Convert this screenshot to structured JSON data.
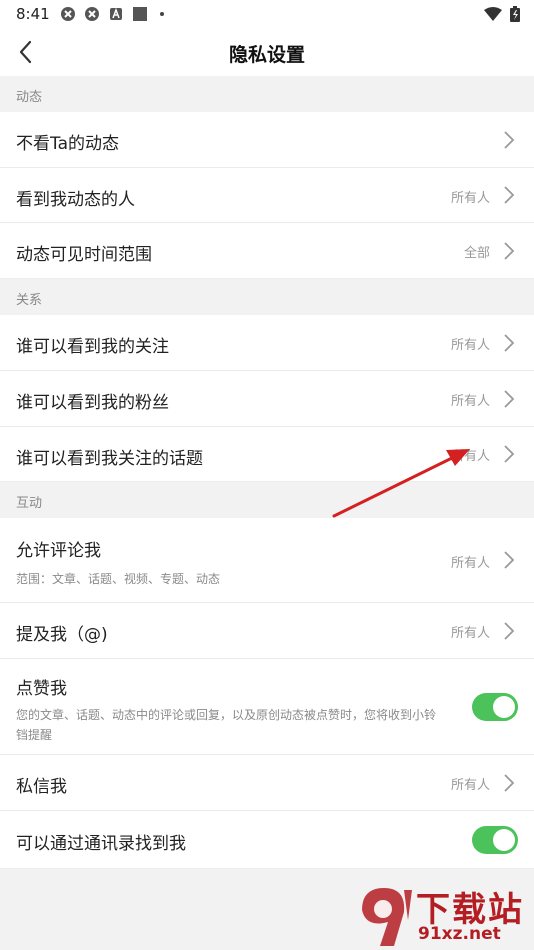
{
  "status_bar": {
    "time": "8:41"
  },
  "header": {
    "title": "隐私设置"
  },
  "sections": [
    {
      "title": "动态",
      "items": [
        {
          "label": "不看Ta的动态",
          "value": ""
        },
        {
          "label": "看到我动态的人",
          "value": "所有人"
        },
        {
          "label": "动态可见时间范围",
          "value": "全部"
        }
      ]
    },
    {
      "title": "关系",
      "items": [
        {
          "label": "谁可以看到我的关注",
          "value": "所有人"
        },
        {
          "label": "谁可以看到我的粉丝",
          "value": "所有人"
        },
        {
          "label": "谁可以看到我关注的话题",
          "value": "所有人"
        }
      ]
    },
    {
      "title": "互动",
      "items": [
        {
          "label": "允许评论我",
          "sub": "范围：文章、话题、视频、专题、动态",
          "value": "所有人"
        },
        {
          "label": "提及我（@)",
          "value": "所有人"
        },
        {
          "label": "点赞我",
          "sub": "您的文章、话题、动态中的评论或回复，以及原创动态被点赞时，您将收到小铃铛提醒",
          "toggle": true
        },
        {
          "label": "私信我",
          "value": "所有人"
        },
        {
          "label": "可以通过通讯录找到我",
          "toggle": true
        }
      ]
    }
  ],
  "colors": {
    "toggle_on": "#4cc35a",
    "annotation_arrow": "#d42020",
    "watermark": "#b41e23"
  },
  "watermark": {
    "text": "下载站",
    "url": "91xz.net"
  }
}
